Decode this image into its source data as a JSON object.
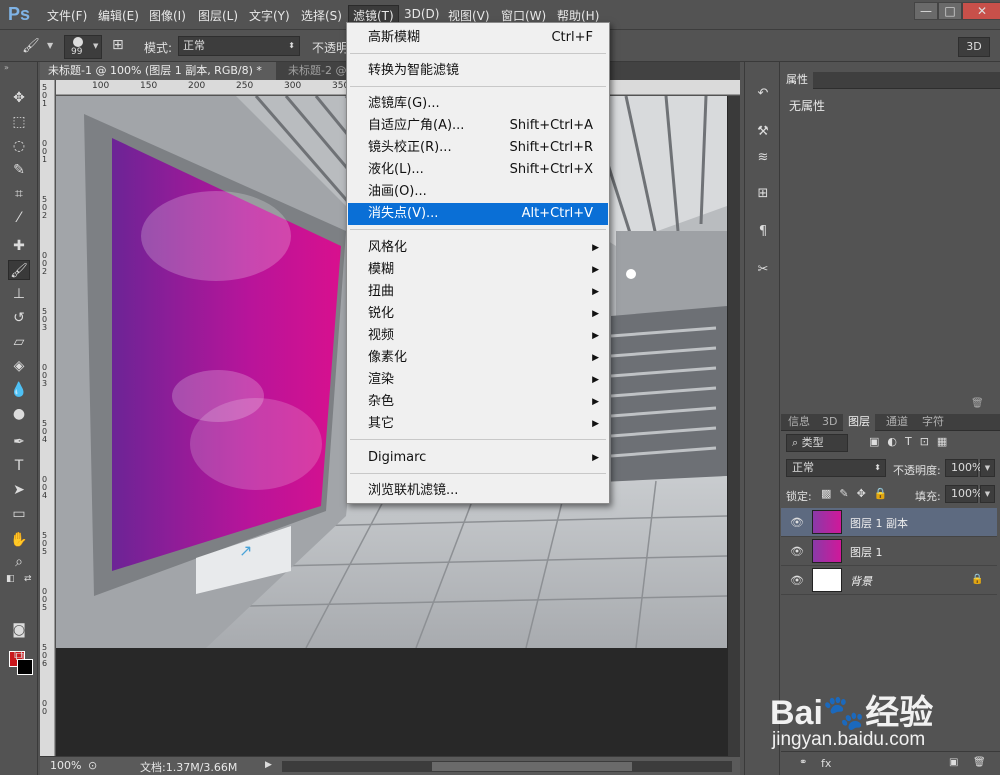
{
  "app": {
    "logo": "Ps",
    "menu": [
      "文件(F)",
      "编辑(E)",
      "图像(I)",
      "图层(L)",
      "文字(Y)",
      "选择(S)",
      "滤镜(T)",
      "3D(D)",
      "视图(V)",
      "窗口(W)",
      "帮助(H)"
    ],
    "window_buttons": [
      "—",
      "□",
      "✕"
    ]
  },
  "options_bar": {
    "brush_size": "99",
    "mode_label": "模式:",
    "mode_value": "正常",
    "opacity_label": "不透明",
    "btn_3d": "3D"
  },
  "document": {
    "tabs": [
      "未标题-1 @ 100% (图层 1 副本, RGB/8) *",
      "未标题-2 @"
    ],
    "ruler_h": [
      "100",
      "150",
      "200",
      "250",
      "300",
      "350"
    ],
    "ruler_v": [
      "5",
      "0",
      "1",
      "0",
      "0",
      "1",
      "5",
      "0",
      "2",
      "0",
      "0",
      "2",
      "5",
      "0",
      "3",
      "0",
      "0",
      "3",
      "5",
      "0",
      "4",
      "0",
      "0",
      "4",
      "5",
      "0",
      "5",
      "0",
      "0",
      "5",
      "5",
      "0",
      "6",
      "0",
      "0"
    ]
  },
  "status": {
    "zoom": "100%",
    "doc_info": "文档:1.37M/3.66M"
  },
  "filter_menu": {
    "items": [
      {
        "label": "高斯模糊",
        "shortcut": "Ctrl+F"
      },
      {
        "label": "转换为智能滤镜",
        "shortcut": ""
      },
      {
        "label": "滤镜库(G)...",
        "shortcut": ""
      },
      {
        "label": "自适应广角(A)...",
        "shortcut": "Shift+Ctrl+A"
      },
      {
        "label": "镜头校正(R)...",
        "shortcut": "Shift+Ctrl+R"
      },
      {
        "label": "液化(L)...",
        "shortcut": "Shift+Ctrl+X"
      },
      {
        "label": "油画(O)...",
        "shortcut": ""
      },
      {
        "label": "消失点(V)...",
        "shortcut": "Alt+Ctrl+V"
      },
      {
        "label": "风格化",
        "shortcut": ""
      },
      {
        "label": "模糊",
        "shortcut": ""
      },
      {
        "label": "扭曲",
        "shortcut": ""
      },
      {
        "label": "锐化",
        "shortcut": ""
      },
      {
        "label": "视频",
        "shortcut": ""
      },
      {
        "label": "像素化",
        "shortcut": ""
      },
      {
        "label": "渲染",
        "shortcut": ""
      },
      {
        "label": "杂色",
        "shortcut": ""
      },
      {
        "label": "其它",
        "shortcut": ""
      },
      {
        "label": "Digimarc",
        "shortcut": ""
      },
      {
        "label": "浏览联机滤镜...",
        "shortcut": ""
      }
    ],
    "submenu_arrow": "▶"
  },
  "properties_panel": {
    "tab": "属性",
    "content": "无属性"
  },
  "layers_panel": {
    "tabs": [
      "信息",
      "3D",
      "图层",
      "通道",
      "字符"
    ],
    "filter_kind": "类型",
    "blend_mode": "正常",
    "opacity_label": "不透明度:",
    "opacity_value": "100%",
    "lock_label": "锁定:",
    "fill_label": "填充:",
    "fill_value": "100%",
    "layers": [
      "图层 1 副本",
      "图层 1",
      "背景"
    ],
    "footer_icons": [
      "fx"
    ]
  },
  "watermark": {
    "brand": "Bai🐾经验",
    "url": "jingyan.baidu.com"
  },
  "colors": {
    "accent_highlight": "#0a6fd6",
    "foreground": "#c8171c",
    "background": "#000000",
    "selected_layer": "#5d6a80"
  }
}
